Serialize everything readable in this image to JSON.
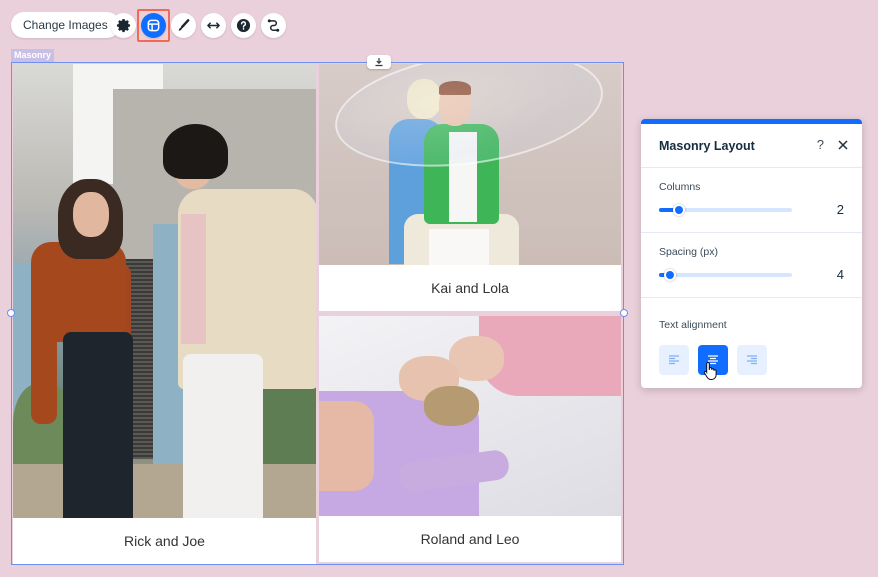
{
  "toolbar": {
    "change_images_label": "Change Images",
    "tools": [
      {
        "name": "settings",
        "icon": "gear-icon"
      },
      {
        "name": "layout",
        "icon": "layout-icon",
        "active": true
      },
      {
        "name": "design",
        "icon": "paintbrush-icon"
      },
      {
        "name": "stretch",
        "icon": "horizontal-arrows-icon"
      },
      {
        "name": "help",
        "icon": "question-icon"
      },
      {
        "name": "animation",
        "icon": "animation-path-icon"
      }
    ]
  },
  "gallery": {
    "element_label": "Masonry",
    "items": [
      {
        "caption": "Rick and Joe"
      },
      {
        "caption": "Kai and Lola"
      },
      {
        "caption": "Roland and Leo"
      }
    ]
  },
  "panel": {
    "title": "Masonry Layout",
    "help_label": "?",
    "columns": {
      "label": "Columns",
      "value": "2",
      "fraction": 0.15
    },
    "spacing": {
      "label": "Spacing (px)",
      "value": "4",
      "fraction": 0.08
    },
    "text_alignment": {
      "label": "Text alignment",
      "options": [
        "left",
        "center",
        "right"
      ],
      "selected": "center"
    }
  },
  "colors": {
    "accent": "#116dff",
    "background": "#e9d0da",
    "selection_border": "#6c8ff0",
    "highlight_frame": "#f26a4f"
  }
}
